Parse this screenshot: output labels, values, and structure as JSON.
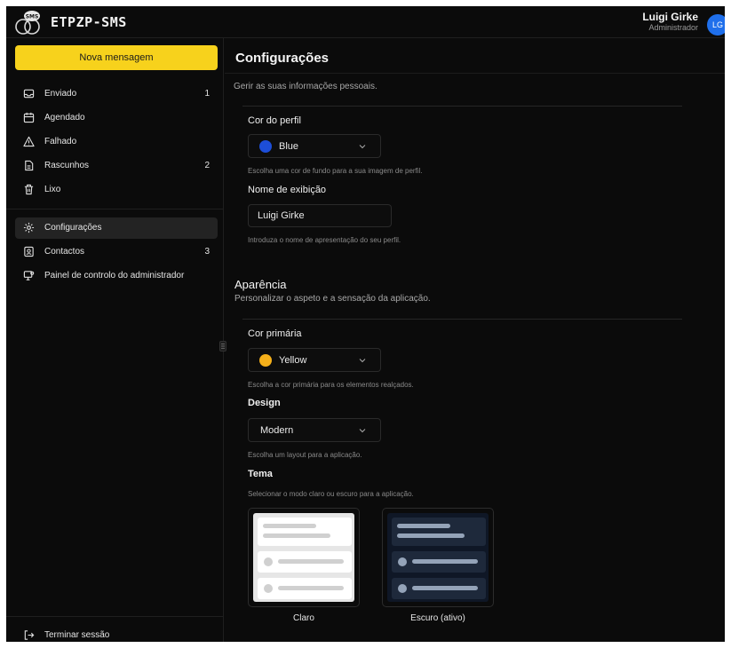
{
  "header": {
    "app_name": "ETPZP-SMS",
    "logo_text": "SMS",
    "user_name": "Luigi Girke",
    "user_role": "Administrador",
    "avatar_initials": "LG"
  },
  "sidebar": {
    "compose_label": "Nova mensagem",
    "items": [
      {
        "label": "Enviado",
        "count": "1",
        "icon": "inbox-icon"
      },
      {
        "label": "Agendado",
        "count": "",
        "icon": "calendar-icon"
      },
      {
        "label": "Falhado",
        "count": "",
        "icon": "warning-icon"
      },
      {
        "label": "Rascunhos",
        "count": "2",
        "icon": "file-icon"
      },
      {
        "label": "Lixo",
        "count": "",
        "icon": "trash-icon"
      },
      {
        "label": "Configurações",
        "count": "",
        "icon": "gear-icon"
      },
      {
        "label": "Contactos",
        "count": "3",
        "icon": "contacts-icon"
      },
      {
        "label": "Painel de controlo do administrador",
        "count": "",
        "icon": "admin-icon"
      }
    ],
    "logout_label": "Terminar sessão"
  },
  "main": {
    "title": "Configurações",
    "subtitle": "Gerir as suas informações pessoais.",
    "profile_color": {
      "label": "Cor do perfil",
      "value": "Blue",
      "hint": "Escolha uma cor de fundo para a sua imagem de perfil."
    },
    "display_name": {
      "label": "Nome de exibição",
      "value": "Luigi Girke",
      "hint": "Introduza o nome de apresentação do seu perfil."
    },
    "appearance": {
      "title": "Aparência",
      "subtitle": "Personalizar o aspeto e a sensação da aplicação."
    },
    "primary_color": {
      "label": "Cor primária",
      "value": "Yellow",
      "hint": "Escolha a cor primária para os elementos realçados."
    },
    "design": {
      "label": "Design",
      "value": "Modern",
      "hint": "Escolha um layout para a aplicação."
    },
    "theme": {
      "label": "Tema",
      "hint": "Selecionar o modo claro ou escuro para a aplicação.",
      "light_label": "Claro",
      "dark_label": "Escuro (ativo)"
    }
  },
  "colors": {
    "accent_yellow": "#f7d21c",
    "profile_blue": "#1d4ed8",
    "primary_yellow": "#f5b01a",
    "background": "#0b0b0b"
  }
}
